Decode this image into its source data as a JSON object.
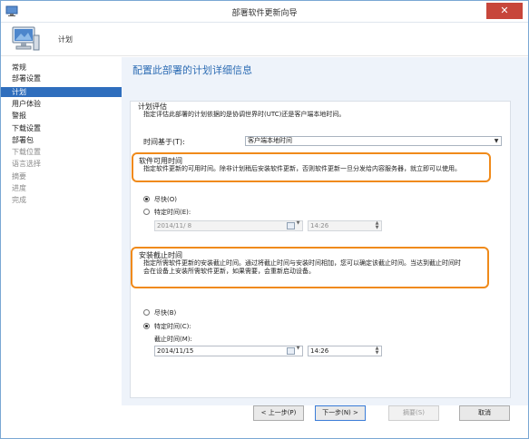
{
  "window": {
    "title": "部署软件更新向导",
    "close": "✕"
  },
  "header": {
    "title": "计划"
  },
  "nav": {
    "items": [
      {
        "label": "常规",
        "state": "normal"
      },
      {
        "label": "部署设置",
        "state": "normal"
      },
      {
        "label": "计划",
        "state": "active"
      },
      {
        "label": "用户体验",
        "state": "normal"
      },
      {
        "label": "警报",
        "state": "normal"
      },
      {
        "label": "下载设置",
        "state": "normal"
      },
      {
        "label": "部署包",
        "state": "normal"
      },
      {
        "label": "下载位置",
        "state": "disabled"
      },
      {
        "label": "语言选择",
        "state": "disabled"
      },
      {
        "label": "摘要",
        "state": "disabled"
      },
      {
        "label": "进度",
        "state": "disabled"
      },
      {
        "label": "完成",
        "state": "disabled"
      }
    ]
  },
  "main": {
    "page_title": "配置此部署的计划详细信息",
    "schedule_eval": {
      "label": "计划评估",
      "desc": "指定评估此部署的计划依据的是协调世界时(UTC)还是客户端本地时间。",
      "time_based_label": "时间基于(T):",
      "time_based_value": "客户端本地时间"
    },
    "availability": {
      "label": "软件可用时间",
      "desc": "指定软件更新的可用时间。除非计划稍后安装软件更新，否则软件更新一旦分发给内容服务器，就立即可以使用。",
      "asap_label": "尽快(O)",
      "specific_label": "特定时间(E):",
      "date_value": "2014/11/ 8",
      "time_value": "14:26"
    },
    "deadline": {
      "label": "安装截止时间",
      "desc_line1": "指定所需软件更新的安装截止时间。通过将截止时间与安装时间相加，您可以确定该截止时间。当达到截止时间时",
      "desc_line2": "会在设备上安装所需软件更新，如果需要，会重新启动设备。",
      "asap_label": "尽快(B)",
      "specific_label": "特定时间(C):",
      "deadline_label": "截止时间(M):",
      "date_value": "2014/11/15",
      "time_value": "14:26"
    }
  },
  "buttons": {
    "back": "< 上一步(P)",
    "next": "下一步(N) >",
    "summary": "摘要(S)",
    "cancel": "取消"
  }
}
